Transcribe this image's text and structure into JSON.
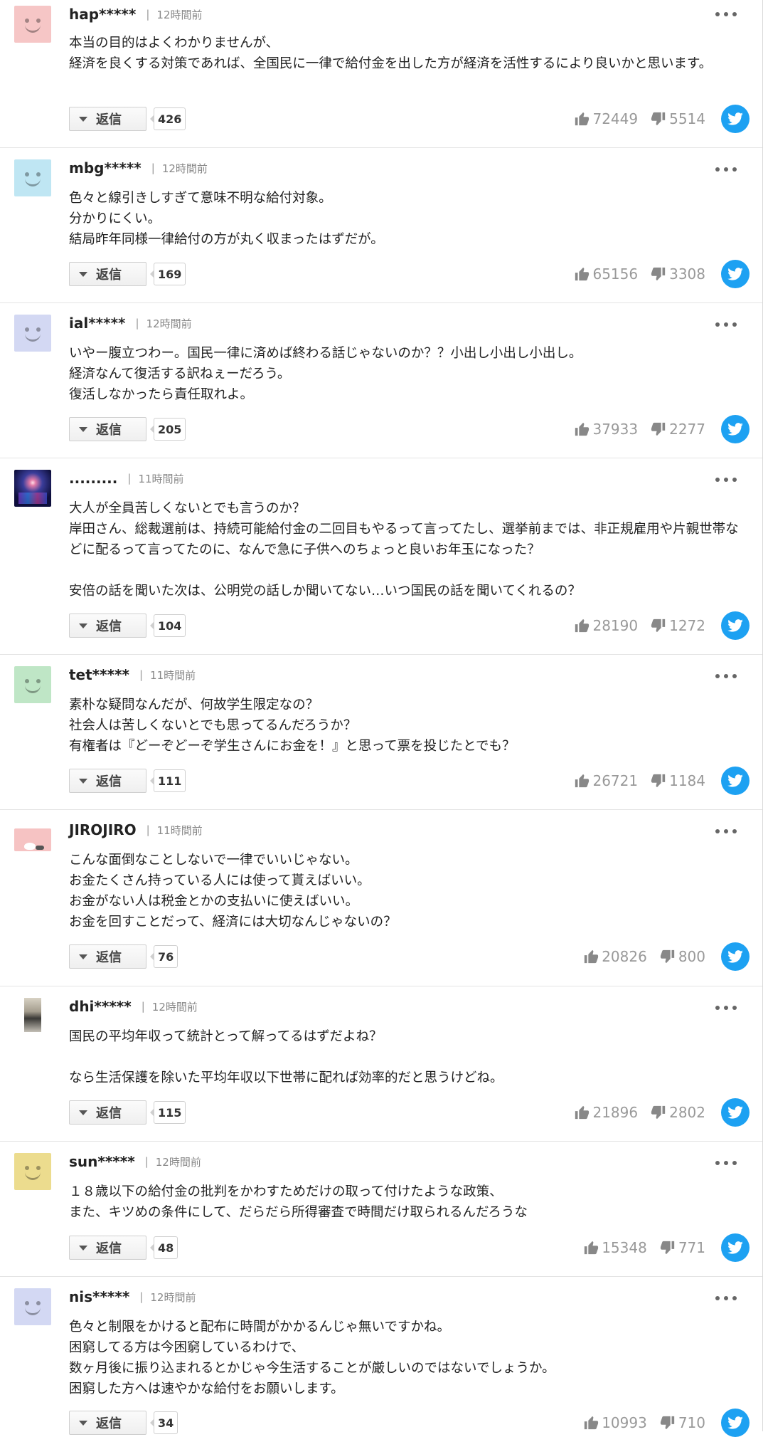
{
  "reply_label": "返信",
  "comments": [
    {
      "user": "hap*****",
      "time": "12時間前",
      "avatar": "avatar-pink-face-icon",
      "avatar_color": "#f6c6c6",
      "text": "本当の目的はよくわかりませんが、\n経済を良くする対策であれば、全国民に一律で給付金を出した方が経済を活性するにより良いかと思います。",
      "replies": "426",
      "likes": "72449",
      "dislikes": "5514"
    },
    {
      "user": "mbg*****",
      "time": "12時間前",
      "avatar": "avatar-lightblue-face-icon",
      "avatar_color": "#bfe6f3",
      "text": "色々と線引きしすぎて意味不明な給付対象。\n分かりにくい。\n結局昨年同様一律給付の方が丸く収まったはずだが。",
      "replies": "169",
      "likes": "65156",
      "dislikes": "3308"
    },
    {
      "user": "ial*****",
      "time": "12時間前",
      "avatar": "avatar-lavender-face-icon",
      "avatar_color": "#d3d8f3",
      "text": "いやー腹立つわー。国民一律に済めば終わる話じゃないのか？？小出し小出し小出し。\n経済なんて復活する訳ねぇーだろう。\n復活しなかったら責任取れよ。",
      "replies": "205",
      "likes": "37933",
      "dislikes": "2277"
    },
    {
      "user": ".........",
      "time": "11時間前",
      "avatar": "avatar-concert-photo-icon",
      "avatar_color": "#1c1d55",
      "text": "大人が全員苦しくないとでも言うのか？\n岸田さん、総裁選前は、持続可能給付金の二回目もやるって言ってたし、選挙前までは、非正規雇用や片親世帯などに配るって言ってたのに、なんで急に子供へのちょっと良いお年玉になった？\n\n安倍の話を聞いた次は、公明党の話しか聞いてない…いつ国民の話を聞いてくれるの？",
      "replies": "104",
      "likes": "28190",
      "dislikes": "1272"
    },
    {
      "user": "tet*****",
      "time": "11時間前",
      "avatar": "avatar-green-face-icon",
      "avatar_color": "#bfe6c6",
      "text": "素朴な疑問なんだが、何故学生限定なの？\n社会人は苦しくないとでも思ってるんだろうか？\n有権者は『どーぞどーぞ学生さんにお金を！』と思って票を投じたとでも？",
      "replies": "111",
      "likes": "26721",
      "dislikes": "1184"
    },
    {
      "user": "JIROJIRO",
      "time": "11時間前",
      "avatar": "avatar-cat-photo-icon",
      "avatar_color": "#f6c3c3",
      "text": "こんな面倒なことしないで一律でいいじゃない。\nお金たくさん持っている人には使って貰えばいい。\nお金がない人は税金とかの支払いに使えばいい。\nお金を回すことだって、経済には大切なんじゃないの？",
      "replies": "76",
      "likes": "20826",
      "dislikes": "800"
    },
    {
      "user": "dhi*****",
      "time": "12時間前",
      "avatar": "avatar-person-photo-icon",
      "avatar_color": "#ffffff",
      "text": "国民の平均年収って統計とって解ってるはずだよね？\n\nなら生活保護を除いた平均年収以下世帯に配れば効率的だと思うけどね。",
      "replies": "115",
      "likes": "21896",
      "dislikes": "2802"
    },
    {
      "user": "sun*****",
      "time": "12時間前",
      "avatar": "avatar-yellow-face-icon",
      "avatar_color": "#ecdc8e",
      "text": "１８歳以下の給付金の批判をかわすためだけの取って付けたような政策、\nまた、キツめの条件にして、だらだら所得審査で時間だけ取られるんだろうな",
      "replies": "48",
      "likes": "15348",
      "dislikes": "771"
    },
    {
      "user": "nis*****",
      "time": "12時間前",
      "avatar": "avatar-lavender-face-icon",
      "avatar_color": "#d3d8f3",
      "text": "色々と制限をかけると配布に時間がかかるんじゃ無いですかね。\n困窮してる方は今困窮しているわけで、\n数ヶ月後に振り込まれるとかじゃ今生活することが厳しいのではないでしょうか。\n困窮した方へは速やかな給付をお願いします。",
      "replies": "34",
      "likes": "10993",
      "dislikes": "710"
    }
  ]
}
